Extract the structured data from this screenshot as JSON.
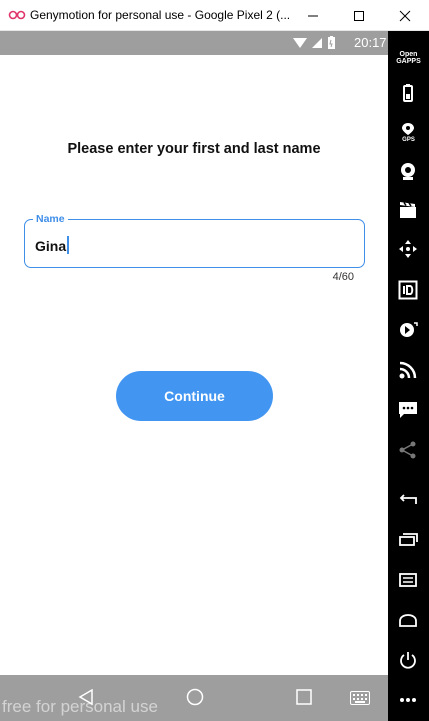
{
  "window": {
    "title": "Genymotion for personal use - Google Pixel 2 (..."
  },
  "status_bar": {
    "time": "20:17"
  },
  "screen": {
    "heading": "Please enter your first and last name",
    "name_field": {
      "label": "Name",
      "value": "Gina",
      "counter": "4/60"
    },
    "continue_label": "Continue"
  },
  "nav_bar": {
    "watermark": "free for personal use"
  },
  "sidebar": {
    "opengapps_label": "Open GAPPS",
    "gps_label": "GPS",
    "tools": [
      "opengapps",
      "battery",
      "gps",
      "webcam",
      "capture",
      "dpad",
      "identifiers",
      "media",
      "cast",
      "sms",
      "share",
      "back",
      "recent-apps",
      "menu",
      "home",
      "power",
      "more"
    ]
  },
  "colors": {
    "accent": "#3f8ee8",
    "button": "#4296f2",
    "statusbar": "#9e9e9e",
    "sidebar": "#000000"
  }
}
